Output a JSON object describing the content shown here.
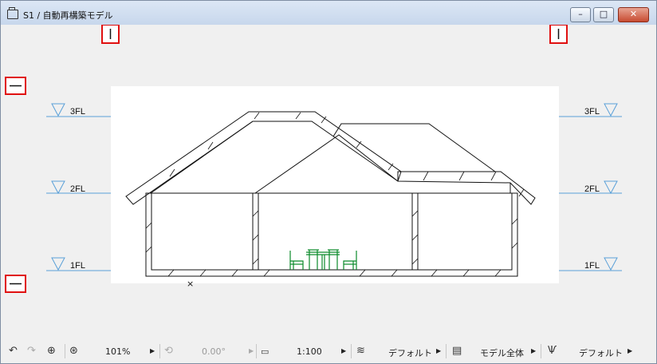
{
  "window": {
    "title": "S1 / 自動再構築モデル",
    "minimize_glyph": "–",
    "maximize_glyph": "□",
    "close_glyph": "✕"
  },
  "drawing": {
    "story_levels": [
      {
        "label_left": "3FL",
        "label_right": "3FL"
      },
      {
        "label_left": "2FL",
        "label_right": "2FL"
      },
      {
        "label_left": "1FL",
        "label_right": "1FL"
      }
    ],
    "colors": {
      "level_line": "#5aa0d8",
      "furniture": "#0a8a2a",
      "handle_border": "#e01010",
      "paper": "#ffffff"
    },
    "origin_marker": "×"
  },
  "statusbar": {
    "zoom": "101%",
    "rotation": "0.00°",
    "scale": "1:100",
    "pen_set": "デフォルト",
    "model_view": "モデル全体",
    "dimension": "デフォルト",
    "icons": [
      "undo-icon",
      "redo-icon",
      "zoom-in-icon",
      "zoom-out-icon",
      "rotate-icon",
      "scale-icon",
      "pen-set-icon",
      "model-view-icon",
      "dimension-icon"
    ]
  }
}
